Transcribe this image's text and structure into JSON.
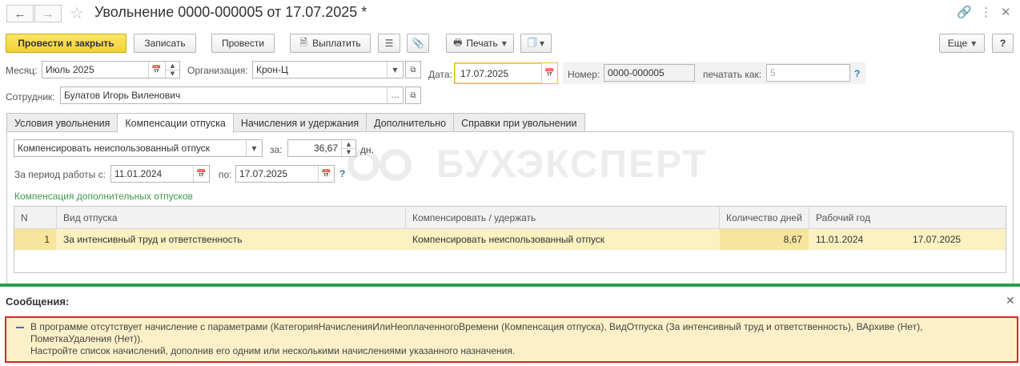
{
  "window": {
    "title": "Увольнение 0000-000005 от 17.07.2025 *",
    "icons": [
      "link-icon",
      "more-vertical-icon",
      "close-icon"
    ]
  },
  "toolbar": {
    "post_close": "Провести и закрыть",
    "save": "Записать",
    "post": "Провести",
    "pay": "Выплатить",
    "print": "Печать",
    "more": "Еще",
    "help": "?"
  },
  "form": {
    "month_label": "Месяц:",
    "month_value": "Июль 2025",
    "org_label": "Организация:",
    "org_value": "Крон-Ц",
    "date_label": "Дата:",
    "date_value": "17.07.2025",
    "number_label": "Номер:",
    "number_value": "0000-000005",
    "print_as_label": "печатать как:",
    "print_as_value": "5",
    "help": "?",
    "employee_label": "Сотрудник:",
    "employee_value": "Булатов Игорь Виленович"
  },
  "tabs": [
    {
      "label": "Условия увольнения"
    },
    {
      "label": "Компенсации отпуска"
    },
    {
      "label": "Начисления и удержания"
    },
    {
      "label": "Дополнительно"
    },
    {
      "label": "Справки при увольнении"
    }
  ],
  "compensation": {
    "type_value": "Компенсировать неиспользованный отпуск",
    "for_label": "за:",
    "days_value": "36,67",
    "days_unit": "дн.",
    "period_label": "За период работы с:",
    "period_from": "11.01.2024",
    "period_to_label": "по:",
    "period_to": "17.07.2025",
    "help": "?",
    "section_title": "Компенсация дополнительных отпусков"
  },
  "watermark": "БУХЭКСПЕРТ",
  "table": {
    "headers": {
      "n": "N",
      "kind": "Вид отпуска",
      "action": "Компенсировать / удержать",
      "days": "Количество дней",
      "year": "Рабочий год"
    },
    "rows": [
      {
        "n": "1",
        "kind": "За интенсивный труд и ответственность",
        "action": "Компенсировать неиспользованный отпуск",
        "days": "8,67",
        "year_from": "11.01.2024",
        "year_to": "17.07.2025"
      }
    ]
  },
  "messages": {
    "title": "Сообщения:",
    "line1": "В программе отсутствует начисление с параметрами (КатегорияНачисленияИлиНеоплаченногоВремени (Компенсация отпуска), ВидОтпуска (За интенсивный труд и ответственность), ВАрхиве (Нет),",
    "line2": "ПометкаУдаления (Нет)).",
    "line3": "Настройте список начислений, дополнив его одним или несколькими начислениями указанного назначения."
  },
  "colors": {
    "primary_button": "#f2d13a",
    "accent_green": "#26a04c",
    "error_border": "#d9252b",
    "selected_row": "#fbf1c1",
    "link_blue": "#2f78c4"
  }
}
